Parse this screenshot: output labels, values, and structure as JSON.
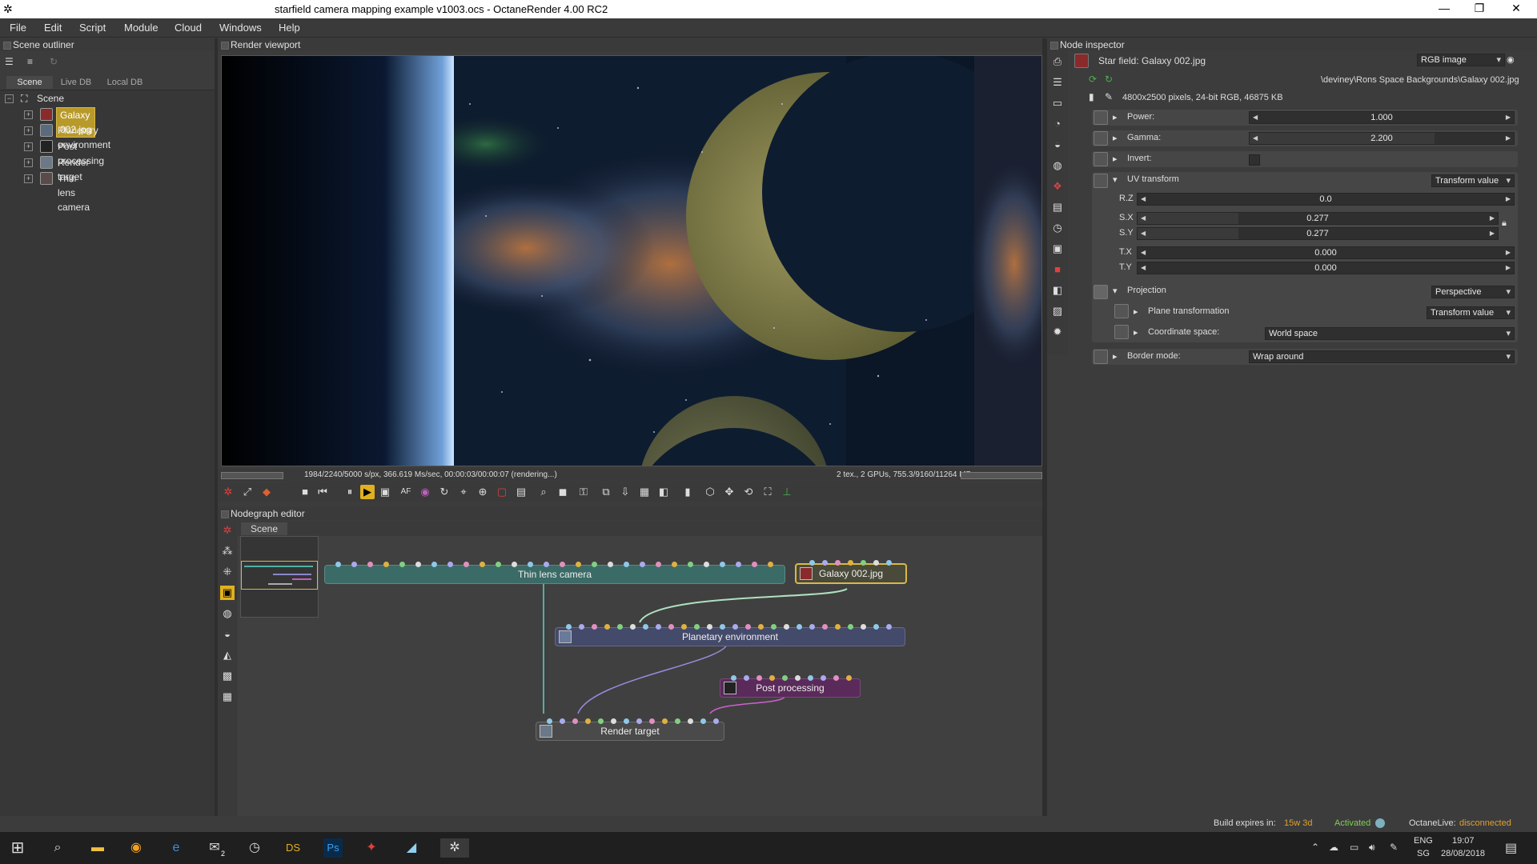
{
  "window": {
    "title": "starfield camera mapping example v1003.ocs - OctaneRender 4.00 RC2"
  },
  "menu": [
    "File",
    "Edit",
    "Script",
    "Module",
    "Cloud",
    "Windows",
    "Help"
  ],
  "outliner": {
    "title": "Scene outliner",
    "tabs": [
      "Scene",
      "Live DB",
      "Local DB"
    ],
    "root": "Scene",
    "items": [
      "Galaxy 002.jpg",
      "Planetary environment",
      "Post processing",
      "Render target",
      "Thin lens camera"
    ]
  },
  "viewport": {
    "title": "Render viewport",
    "status_left": "1984/2240/5000 s/px, 366.619 Ms/sec, 00:00:03/00:00:07 (rendering...)",
    "status_right": "2 tex., 2 GPUs, 755.3/9160/11264 MB"
  },
  "nodegraph": {
    "title": "Nodegraph editor",
    "tab": "Scene",
    "nodes": {
      "camera": "Thin lens camera",
      "galaxy": "Galaxy 002.jpg",
      "planetary": "Planetary environment",
      "post": "Post processing",
      "render_target": "Render target"
    }
  },
  "inspector": {
    "title": "Node inspector",
    "node_name": "Star field: Galaxy 002.jpg",
    "type": "RGB image",
    "path": "\\deviney\\Rons Space Backgrounds\\Galaxy 002.jpg",
    "info": "4800x2500 pixels, 24-bit RGB, 46875 KB",
    "power": {
      "label": "Power:",
      "value": "1.000",
      "fraction": 0.5
    },
    "gamma": {
      "label": "Gamma:",
      "value": "2.200",
      "fraction": 0.7
    },
    "invert": {
      "label": "Invert:",
      "checked": false
    },
    "uv": {
      "label": "UV transform",
      "mode": "Transform value",
      "rz": {
        "label": "R.Z",
        "value": "0.0"
      },
      "sx": {
        "label": "S.X",
        "value": "0.277",
        "fraction": 0.28
      },
      "sy": {
        "label": "S.Y",
        "value": "0.277",
        "fraction": 0.28
      },
      "tx": {
        "label": "T.X",
        "value": "0.000"
      },
      "ty": {
        "label": "T.Y",
        "value": "0.000"
      }
    },
    "projection": {
      "label": "Projection",
      "mode": "Perspective",
      "plane": {
        "label": "Plane transformation",
        "mode": "Transform value"
      },
      "coord": {
        "label": "Coordinate space:",
        "mode": "World space"
      }
    },
    "border": {
      "label": "Border mode:",
      "mode": "Wrap around"
    }
  },
  "bottombar": {
    "build_label": "Build expires in:",
    "build_value": "15w 3d",
    "activated": "Activated",
    "live_label": "OctaneLive:",
    "live_value": "disconnected",
    "accent_green": "#7fcf4f",
    "accent_orange": "#e0a030"
  },
  "taskbar": {
    "lang": "ENG",
    "region": "SG",
    "time": "19:07",
    "date": "28/08/2018",
    "mail_badge": "2"
  }
}
